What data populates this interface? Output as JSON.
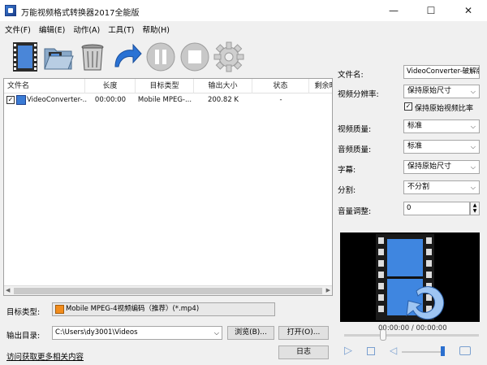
{
  "window": {
    "title": "万能视频格式转换器2017全能版",
    "minimize_glyph": "—",
    "maximize_glyph": "☐",
    "close_glyph": "✕"
  },
  "menu": [
    "文件(F)",
    "编辑(E)",
    "动作(A)",
    "工具(T)",
    "帮助(H)"
  ],
  "toolbar": {
    "icons": [
      "film-add-icon",
      "folder-open-icon",
      "trash-icon",
      "refresh-arrow-icon",
      "pause-icon",
      "stop-icon",
      "gear-icon"
    ]
  },
  "file_list": {
    "columns": [
      "文件名",
      "长度",
      "目标类型",
      "输出大小",
      "状态",
      "剩余时"
    ],
    "rows": [
      {
        "checked": true,
        "name": "VideoConverter-...",
        "length": "00:00:00",
        "target": "Mobile MPEG-...",
        "size": "200.82 K",
        "status": "-"
      }
    ]
  },
  "bottom": {
    "target_type_label": "目标类型:",
    "target_type_value": "Mobile MPEG-4视频编码（推荐）(*.mp4)",
    "output_dir_label": "输出目录:",
    "output_dir_value": "C:\\Users\\dy3001\\Videos",
    "browse_button": "浏览(B)...",
    "open_button": "打开(O)...",
    "log_button": "日志",
    "more_link": "访问获取更多相关内容"
  },
  "panel": {
    "filename_label": "文件名:",
    "filename_value": "VideoConverter-破解版",
    "resolution_label": "视频分辨率:",
    "resolution_value": "保持原始尺寸",
    "keep_ratio_label": "保持原始视频比率",
    "keep_ratio_checked": true,
    "video_quality_label": "视频质量:",
    "video_quality_value": "标准",
    "audio_quality_label": "音频质量:",
    "audio_quality_value": "标准",
    "subtitle_label": "字幕:",
    "subtitle_value": "保持原始尺寸",
    "split_label": "分割:",
    "split_value": "不分割",
    "volume_label": "音量调整:",
    "volume_value": "0",
    "timecode": "00:00:00 / 00:00:00"
  }
}
